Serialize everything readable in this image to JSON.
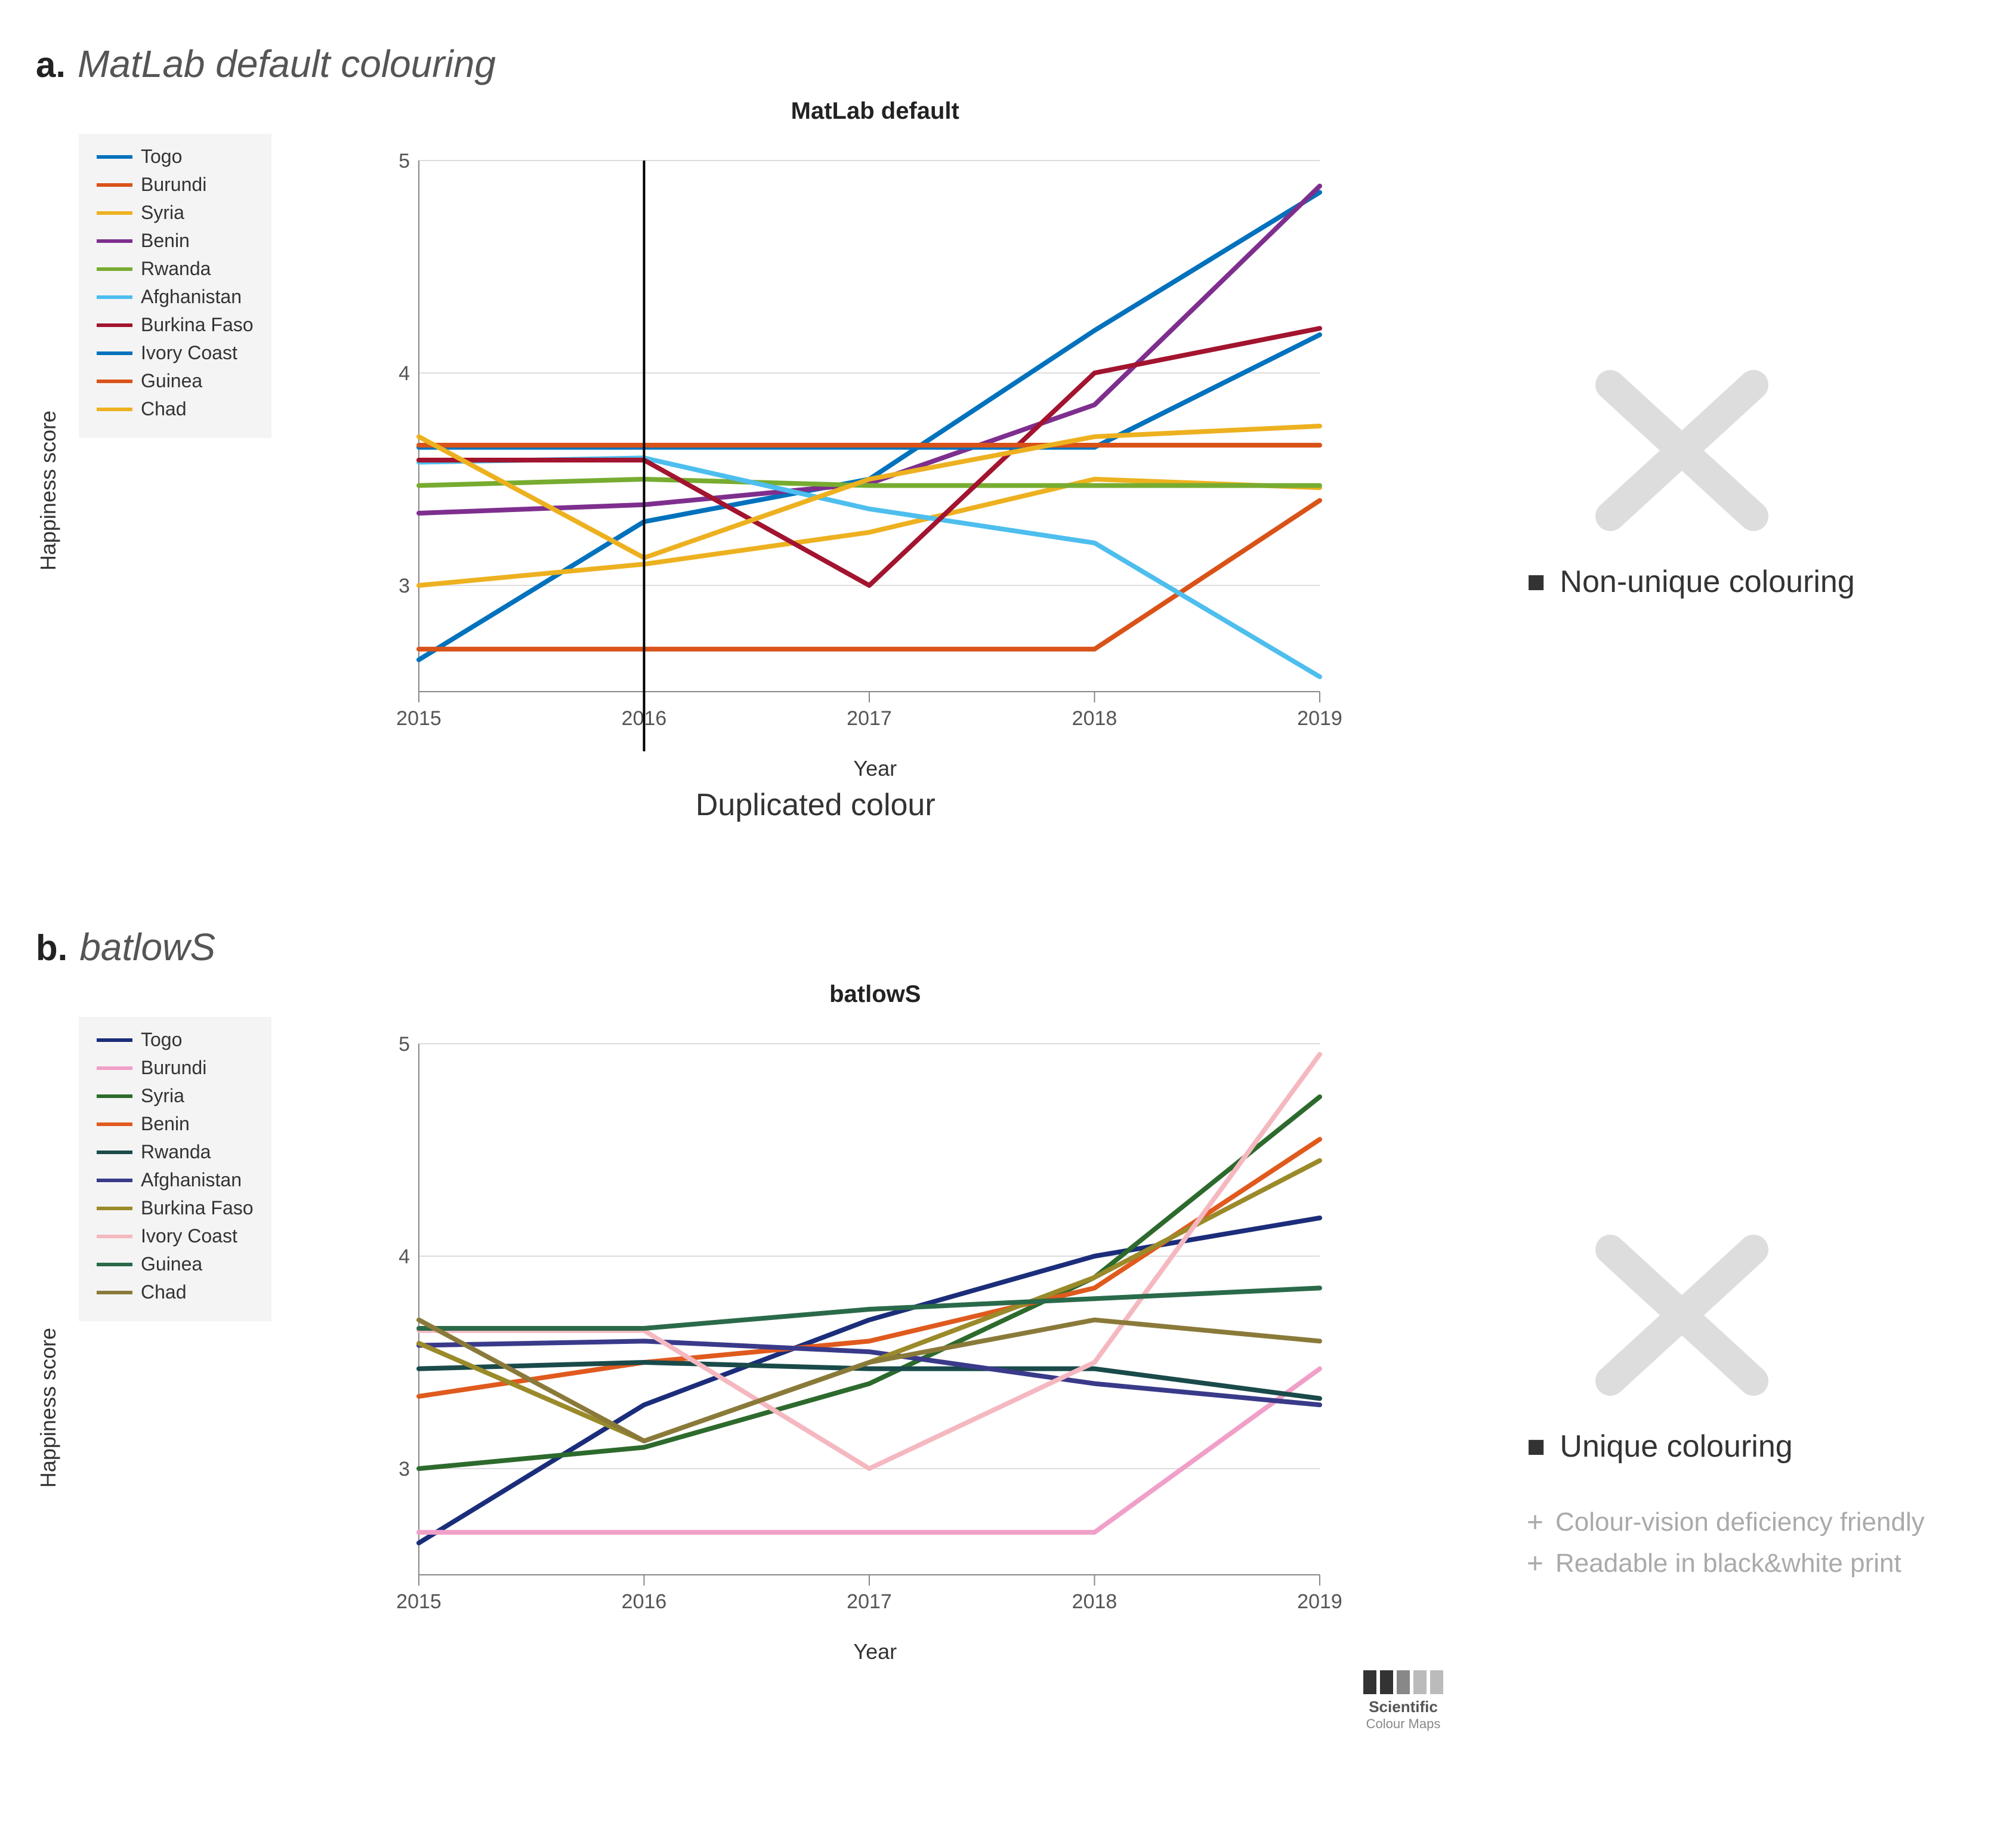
{
  "sectionA": {
    "label": "a.",
    "title": "MatLab default colouring",
    "chartTitle": "MatLab default",
    "yAxisLabel": "Happiness score",
    "xAxisLabel": "Year",
    "years": [
      "2015",
      "2016",
      "2017",
      "2018",
      "2019"
    ],
    "annotation": "Non-unique colouring",
    "duplicatedLabel": "Duplicated colour",
    "legend": [
      {
        "name": "Togo",
        "color": "#0072BD"
      },
      {
        "name": "Burundi",
        "color": "#D95319"
      },
      {
        "name": "Syria",
        "color": "#EDB120"
      },
      {
        "name": "Benin",
        "color": "#7E2F8E"
      },
      {
        "name": "Rwanda",
        "color": "#77AC30"
      },
      {
        "name": "Afghanistan",
        "color": "#4DBEEE"
      },
      {
        "name": "Burkina Faso",
        "color": "#A2142F"
      },
      {
        "name": "Ivory Coast",
        "color": "#0072BD"
      },
      {
        "name": "Guinea",
        "color": "#D95319"
      },
      {
        "name": "Chad",
        "color": "#EDB120"
      }
    ],
    "series": [
      {
        "name": "Togo",
        "color": "#0072BD",
        "values": [
          2.65,
          3.3,
          3.5,
          4.2,
          4.85
        ]
      },
      {
        "name": "Burundi",
        "color": "#D95319",
        "values": [
          2.7,
          2.7,
          2.7,
          2.7,
          3.4
        ]
      },
      {
        "name": "Syria",
        "color": "#EDB120",
        "values": [
          3.0,
          3.1,
          3.25,
          3.5,
          3.46
        ]
      },
      {
        "name": "Benin",
        "color": "#7E2F8E",
        "values": [
          3.34,
          3.38,
          3.48,
          3.85,
          4.88
        ]
      },
      {
        "name": "Rwanda",
        "color": "#77AC30",
        "values": [
          3.47,
          3.5,
          3.47,
          3.47,
          3.47
        ]
      },
      {
        "name": "Afghanistan",
        "color": "#4DBEEE",
        "values": [
          3.58,
          3.6,
          3.36,
          3.2,
          2.57
        ]
      },
      {
        "name": "Burkina Faso",
        "color": "#A2142F",
        "values": [
          3.59,
          3.59,
          3.0,
          4.0,
          4.21
        ]
      },
      {
        "name": "Ivory Coast",
        "color": "#0072BD",
        "values": [
          3.65,
          3.65,
          3.65,
          3.65,
          4.18
        ]
      },
      {
        "name": "Guinea",
        "color": "#D95319",
        "values": [
          3.66,
          3.66,
          3.66,
          3.66,
          3.66
        ]
      },
      {
        "name": "Chad",
        "color": "#EDB120",
        "values": [
          3.7,
          3.13,
          3.5,
          3.7,
          3.75
        ]
      }
    ]
  },
  "sectionB": {
    "label": "b.",
    "title": "batlowS",
    "chartTitle": "batlowS",
    "yAxisLabel": "Happiness score",
    "xAxisLabel": "Year",
    "years": [
      "2015",
      "2016",
      "2017",
      "2018",
      "2019"
    ],
    "annotation": "Unique colouring",
    "annotationSubs": [
      "Colour-vision deficiency friendly",
      "Readable in black&white print"
    ],
    "legend": [
      {
        "name": "Togo",
        "color": "#1b2d7a"
      },
      {
        "name": "Burundi",
        "color": "#f0a0c8"
      },
      {
        "name": "Syria",
        "color": "#2d6a2d"
      },
      {
        "name": "Benin",
        "color": "#e05a1e"
      },
      {
        "name": "Rwanda",
        "color": "#1a4a4a"
      },
      {
        "name": "Afghanistan",
        "color": "#3a3a8a"
      },
      {
        "name": "Burkina Faso",
        "color": "#9a8a2a"
      },
      {
        "name": "Ivory Coast",
        "color": "#f5b8c0"
      },
      {
        "name": "Guinea",
        "color": "#2a6a4a"
      },
      {
        "name": "Chad",
        "color": "#8a7a3a"
      }
    ],
    "series": [
      {
        "name": "Togo",
        "color": "#1b2d7a",
        "values": [
          2.65,
          3.3,
          3.7,
          4.0,
          4.18
        ]
      },
      {
        "name": "Burundi",
        "color": "#f0a0c8",
        "values": [
          2.7,
          2.7,
          2.7,
          2.7,
          3.47
        ]
      },
      {
        "name": "Syria",
        "color": "#2d6a2d",
        "values": [
          3.0,
          3.1,
          3.4,
          3.9,
          4.75
        ]
      },
      {
        "name": "Benin",
        "color": "#e05a1e",
        "values": [
          3.34,
          3.5,
          3.6,
          3.85,
          4.55
        ]
      },
      {
        "name": "Rwanda",
        "color": "#1a4a4a",
        "values": [
          3.47,
          3.5,
          3.47,
          3.47,
          3.33
        ]
      },
      {
        "name": "Afghanistan",
        "color": "#3a3a8a",
        "values": [
          3.58,
          3.6,
          3.55,
          3.4,
          3.3
        ]
      },
      {
        "name": "Burkina Faso",
        "color": "#9a8a2a",
        "values": [
          3.59,
          3.13,
          3.5,
          3.9,
          4.45
        ]
      },
      {
        "name": "Ivory Coast",
        "color": "#f5b8c0",
        "values": [
          3.65,
          3.65,
          3.0,
          3.5,
          4.95
        ]
      },
      {
        "name": "Guinea",
        "color": "#2a6a4a",
        "values": [
          3.66,
          3.66,
          3.75,
          3.8,
          3.85
        ]
      },
      {
        "name": "Chad",
        "color": "#8a7a3a",
        "values": [
          3.7,
          3.13,
          3.5,
          3.7,
          3.6
        ]
      }
    ]
  }
}
